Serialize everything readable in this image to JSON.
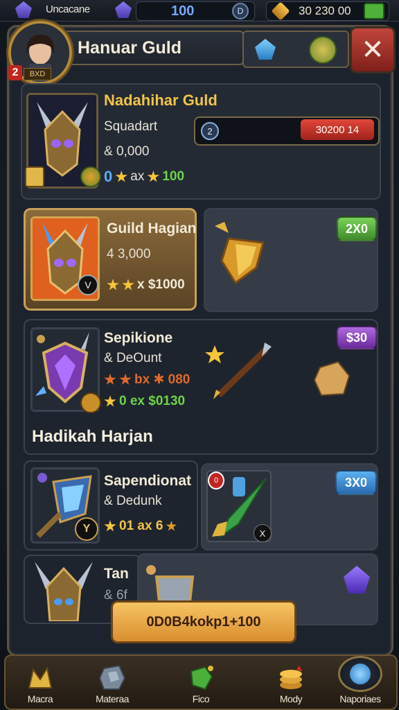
{
  "topbar": {
    "title": "Uncacane",
    "gem_count": "100",
    "coins": "30 230 00",
    "badge_icon": "D"
  },
  "header": {
    "title": "Hanuar Guld",
    "level_badge": "2",
    "level_text": "BXD",
    "close_label": "✕"
  },
  "guild": {
    "name": "Nadahihar Guld",
    "subtitle": "Squadart",
    "line": "& 0,000",
    "stat_prefix": "0",
    "stat_mid": "ax",
    "stat_value": "100",
    "progress_icon": "2",
    "progress_value": "30200 14"
  },
  "items": [
    {
      "name": "Guild Hagian",
      "line": "4 3,000",
      "stats": "x $1000",
      "price": "2X0",
      "badge_letter": "V",
      "price_color": "#57b64a"
    },
    {
      "name": "Sepikione",
      "line": "& DeOunt",
      "stats1": "bx ✱ 080",
      "stats2": "0 ex $0130",
      "price": "$30",
      "price_color": "#8f4ab8"
    },
    {
      "name": "Sapendionat",
      "line": "& Dedunk",
      "stats": "01 ax 6",
      "price": "3X0",
      "badge_letter": "Y",
      "price_color": "#3d7fc7",
      "preview_badge": "X",
      "preview_corner": "0"
    },
    {
      "name": "Tan",
      "line": "& 6f"
    }
  ],
  "section_title": "Hadikah Harjan",
  "buy_button": "0D0B4kokp1+100",
  "nav": [
    {
      "label": "Macra",
      "icon": "crown-icon"
    },
    {
      "label": "Materaa",
      "icon": "ore-icon"
    },
    {
      "label": "Fico",
      "icon": "gem-icon"
    },
    {
      "label": "Mody",
      "icon": "coin-stack-icon"
    },
    {
      "label": "Naporiaes",
      "icon": "potion-icon"
    }
  ]
}
